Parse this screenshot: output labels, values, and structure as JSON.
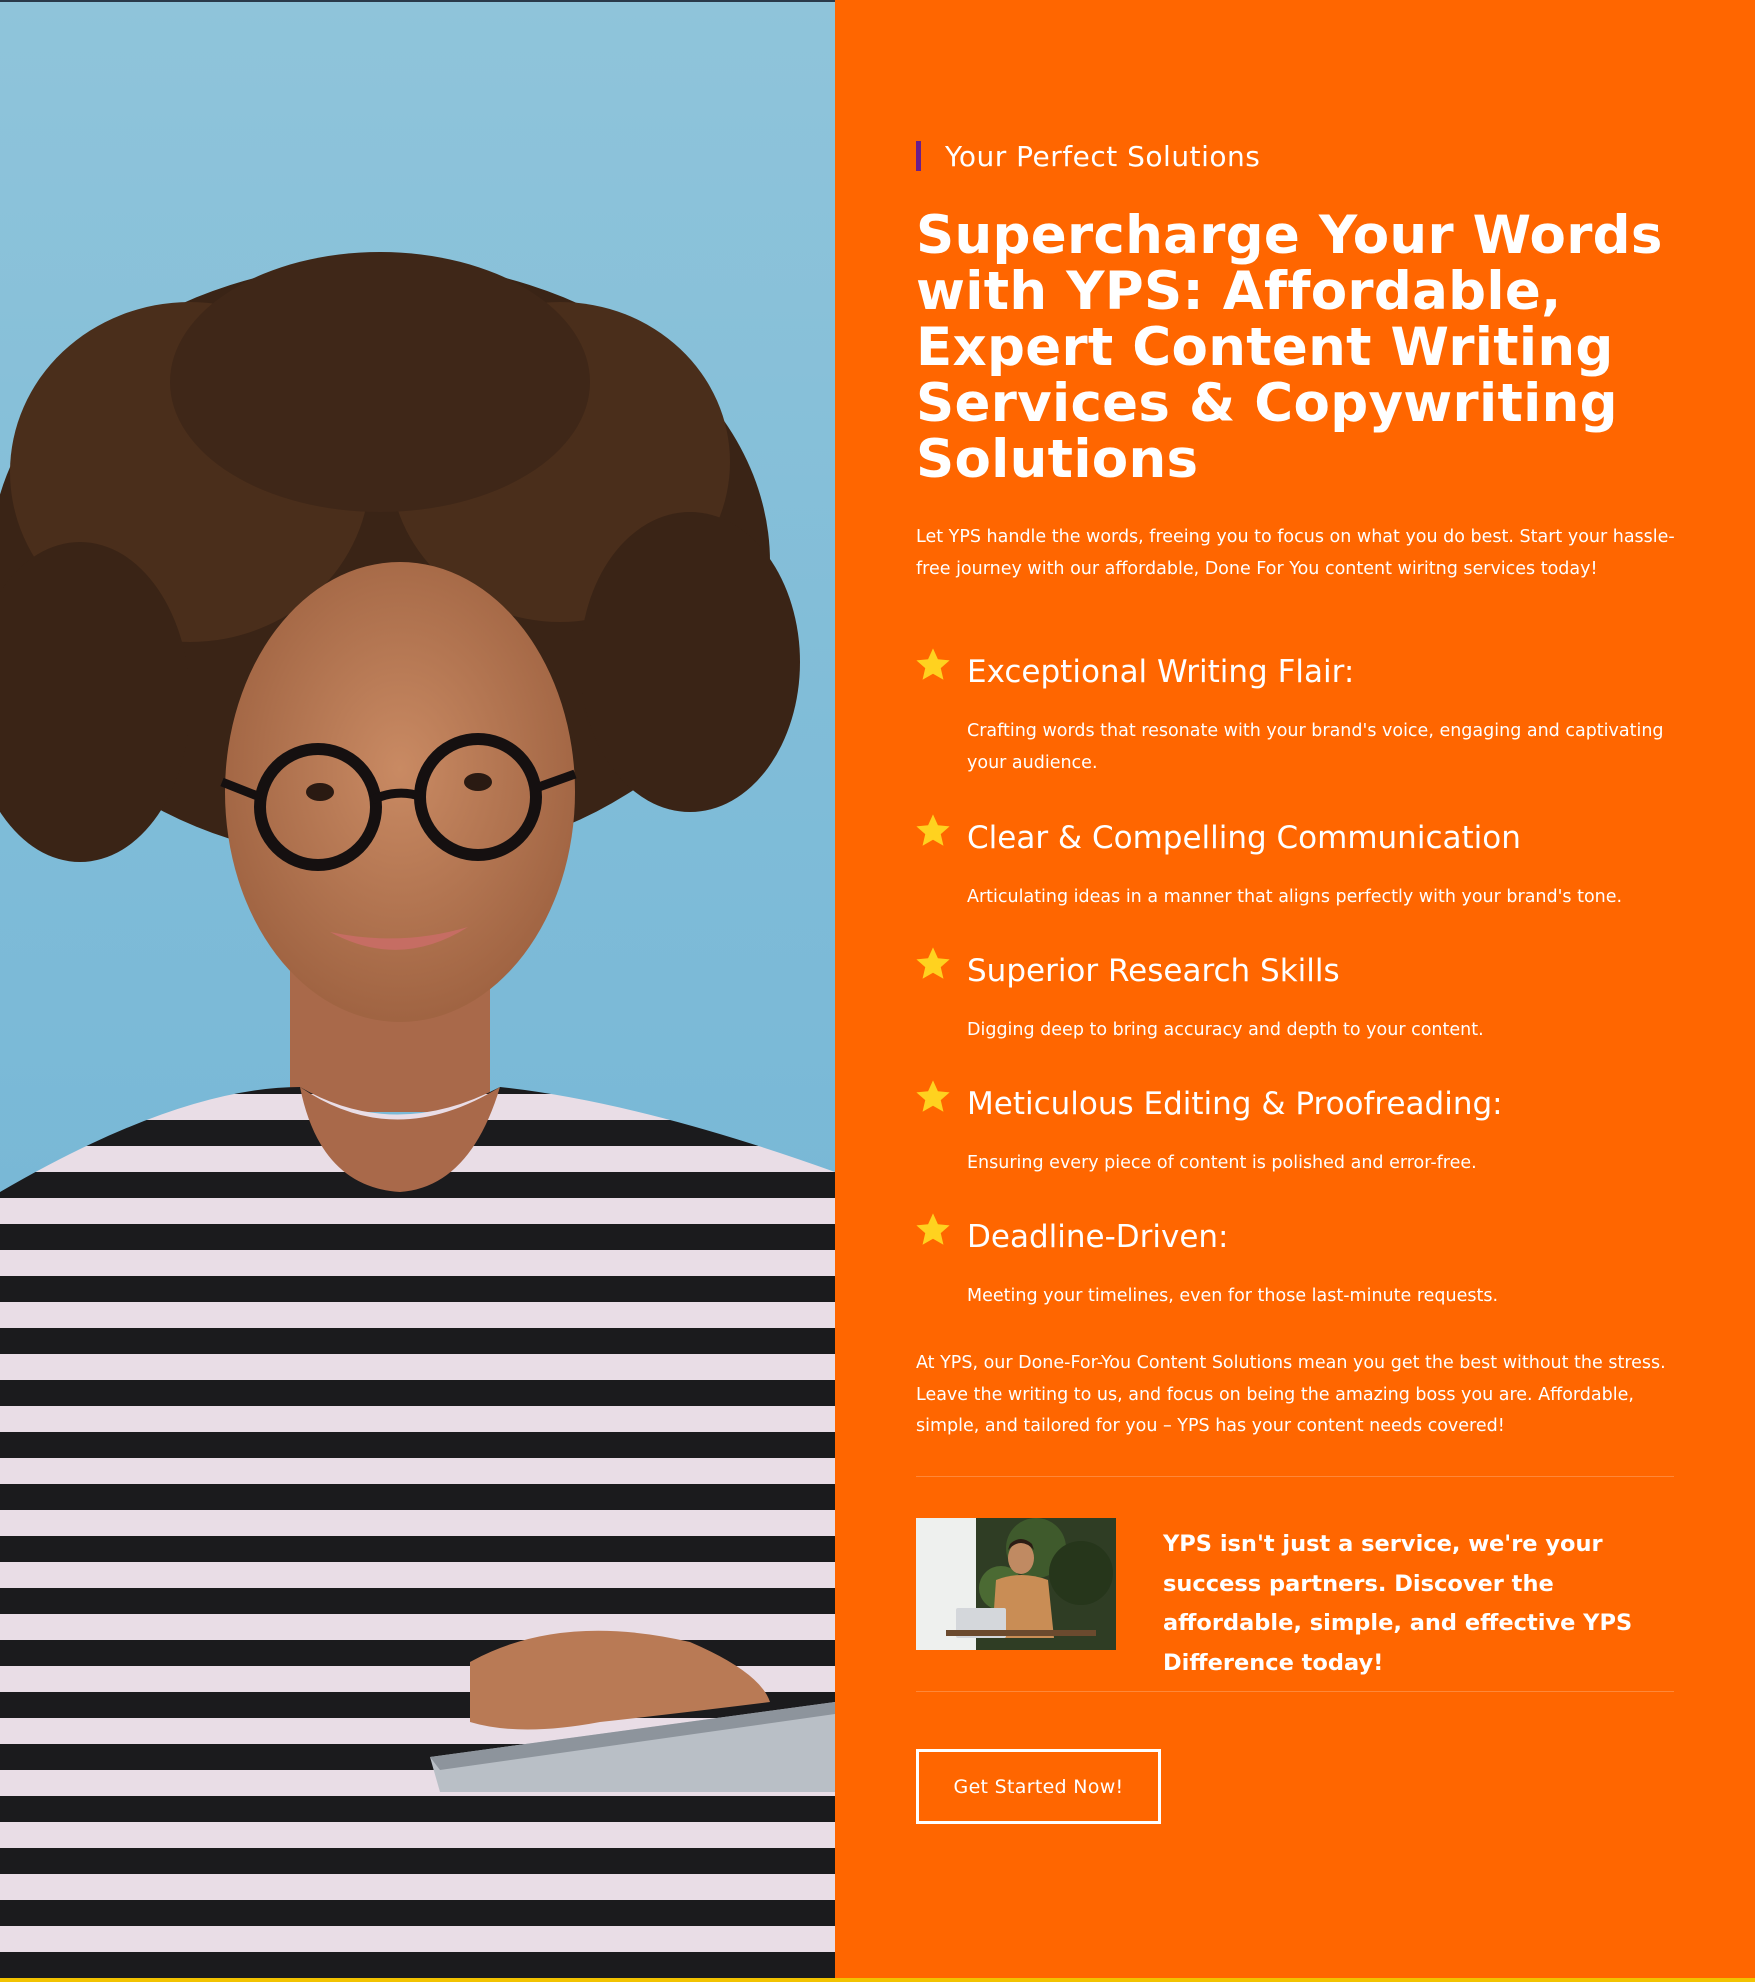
{
  "photos": {
    "hero_alt": "Smiling woman with curly hair and glasses holding a laptop",
    "thumb_alt": "Man working on a laptop at a cafe table"
  },
  "colors": {
    "accent": "#ff6600",
    "eyebrow_bar": "#6b1e8c",
    "star": "#ffd21f",
    "text": "#ffffff"
  },
  "section": {
    "eyebrow": "Your Perfect Solutions",
    "headline": "Supercharge Your Words with YPS: Affordable, Expert Content Writing Services & Copywriting Solutions",
    "intro": "Let YPS handle the words, freeing you to focus on what you do best. Start your hassle-free journey with our affordable, Done For You content wiritng services today!",
    "features": [
      {
        "icon": "star-icon",
        "title": "Exceptional Writing Flair:",
        "description": "Crafting words that resonate with your brand's voice, engaging and captivating your audience."
      },
      {
        "icon": "star-icon",
        "title": "Clear & Compelling Communication",
        "description": "Articulating ideas in a manner that aligns perfectly with your brand's tone."
      },
      {
        "icon": "star-icon",
        "title": "Superior Research Skills",
        "description": "Digging deep to bring accuracy and depth to your content."
      },
      {
        "icon": "star-icon",
        "title": "Meticulous Editing & Proofreading:",
        "description": "Ensuring every piece of content is polished and error-free."
      },
      {
        "icon": "star-icon",
        "title": "Deadline-Driven:",
        "description": "Meeting your timelines, even for those last-minute requests."
      }
    ],
    "closing": "At YPS, our Done-For-You Content Solutions mean you get the best without the stress. Leave the writing to us, and focus on being the amazing boss you are. Affordable, simple, and tailored for you – YPS has your content needs covered!",
    "promo": "YPS isn't just a service, we're your success partners. Discover the affordable, simple, and effective YPS Difference today!",
    "cta_label": "Get Started Now!"
  }
}
